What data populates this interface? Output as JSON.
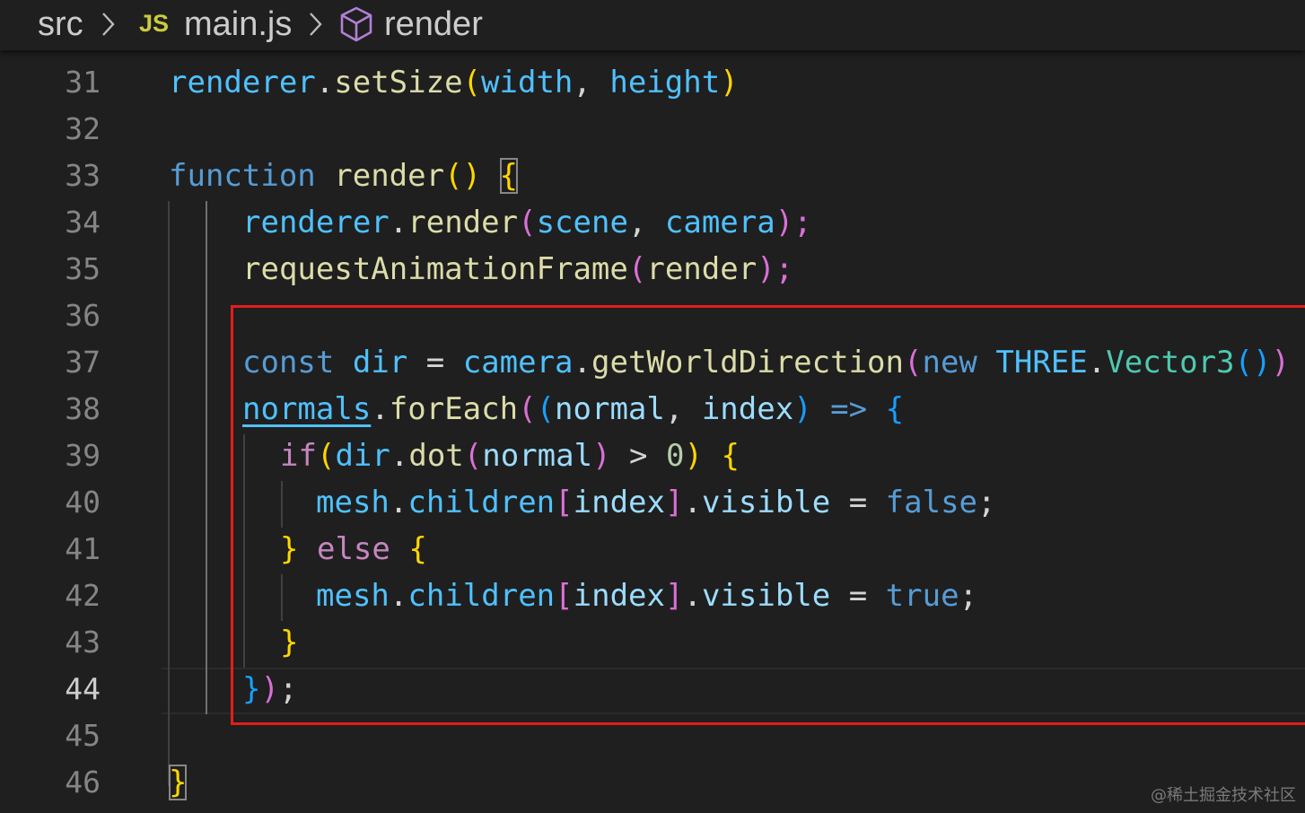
{
  "breadcrumb": {
    "folder": "src",
    "file_icon": "JS",
    "file": "main.js",
    "symbol_icon": "cube-icon",
    "symbol": "render"
  },
  "line_numbers": [
    "31",
    "32",
    "33",
    "34",
    "35",
    "36",
    "37",
    "38",
    "39",
    "40",
    "41",
    "42",
    "43",
    "44",
    "45",
    "46"
  ],
  "active_line": "44",
  "code": {
    "l31": [
      "renderer",
      ".",
      "setSize",
      "(",
      "width",
      ", ",
      "height",
      ")"
    ],
    "l33": [
      "function",
      " ",
      "render",
      "()",
      " ",
      "{"
    ],
    "l34": [
      "renderer",
      ".",
      "render",
      "(",
      "scene",
      ", ",
      "camera",
      ");"
    ],
    "l35": [
      "requestAnimationFrame",
      "(",
      "render",
      ");"
    ],
    "l37": [
      "const",
      " ",
      "dir",
      " = ",
      "camera",
      ".",
      "getWorldDirection",
      "(",
      "new",
      " ",
      "THREE",
      ".",
      "Vector3",
      "()",
      ")"
    ],
    "l38": [
      "normals",
      ".",
      "forEach",
      "(",
      "(",
      "normal",
      ", ",
      "index",
      ")",
      " => ",
      "{"
    ],
    "l39": [
      "if",
      "(",
      "dir",
      ".",
      "dot",
      "(",
      "normal",
      ")",
      " > ",
      "0",
      ")",
      " ",
      "{"
    ],
    "l40": [
      "mesh",
      ".",
      "children",
      "[",
      "index",
      "]",
      ".",
      "visible",
      " = ",
      "false",
      ";"
    ],
    "l41": [
      "}",
      " ",
      "else",
      " ",
      "{"
    ],
    "l42": [
      "mesh",
      ".",
      "children",
      "[",
      "index",
      "]",
      ".",
      "visible",
      " = ",
      "true",
      ";"
    ],
    "l43": [
      "}"
    ],
    "l44": [
      "}",
      ")",
      ";"
    ],
    "l46": [
      "}"
    ]
  },
  "watermark": "@稀土掘金技术社区",
  "colors": {
    "background": "#1f1f1f",
    "annotation_box": "#e51c1c",
    "variable": "#4fc1ff",
    "function": "#dcdcaa",
    "keyword": "#569cd6",
    "control": "#c586c0",
    "class": "#4ec9b0"
  }
}
